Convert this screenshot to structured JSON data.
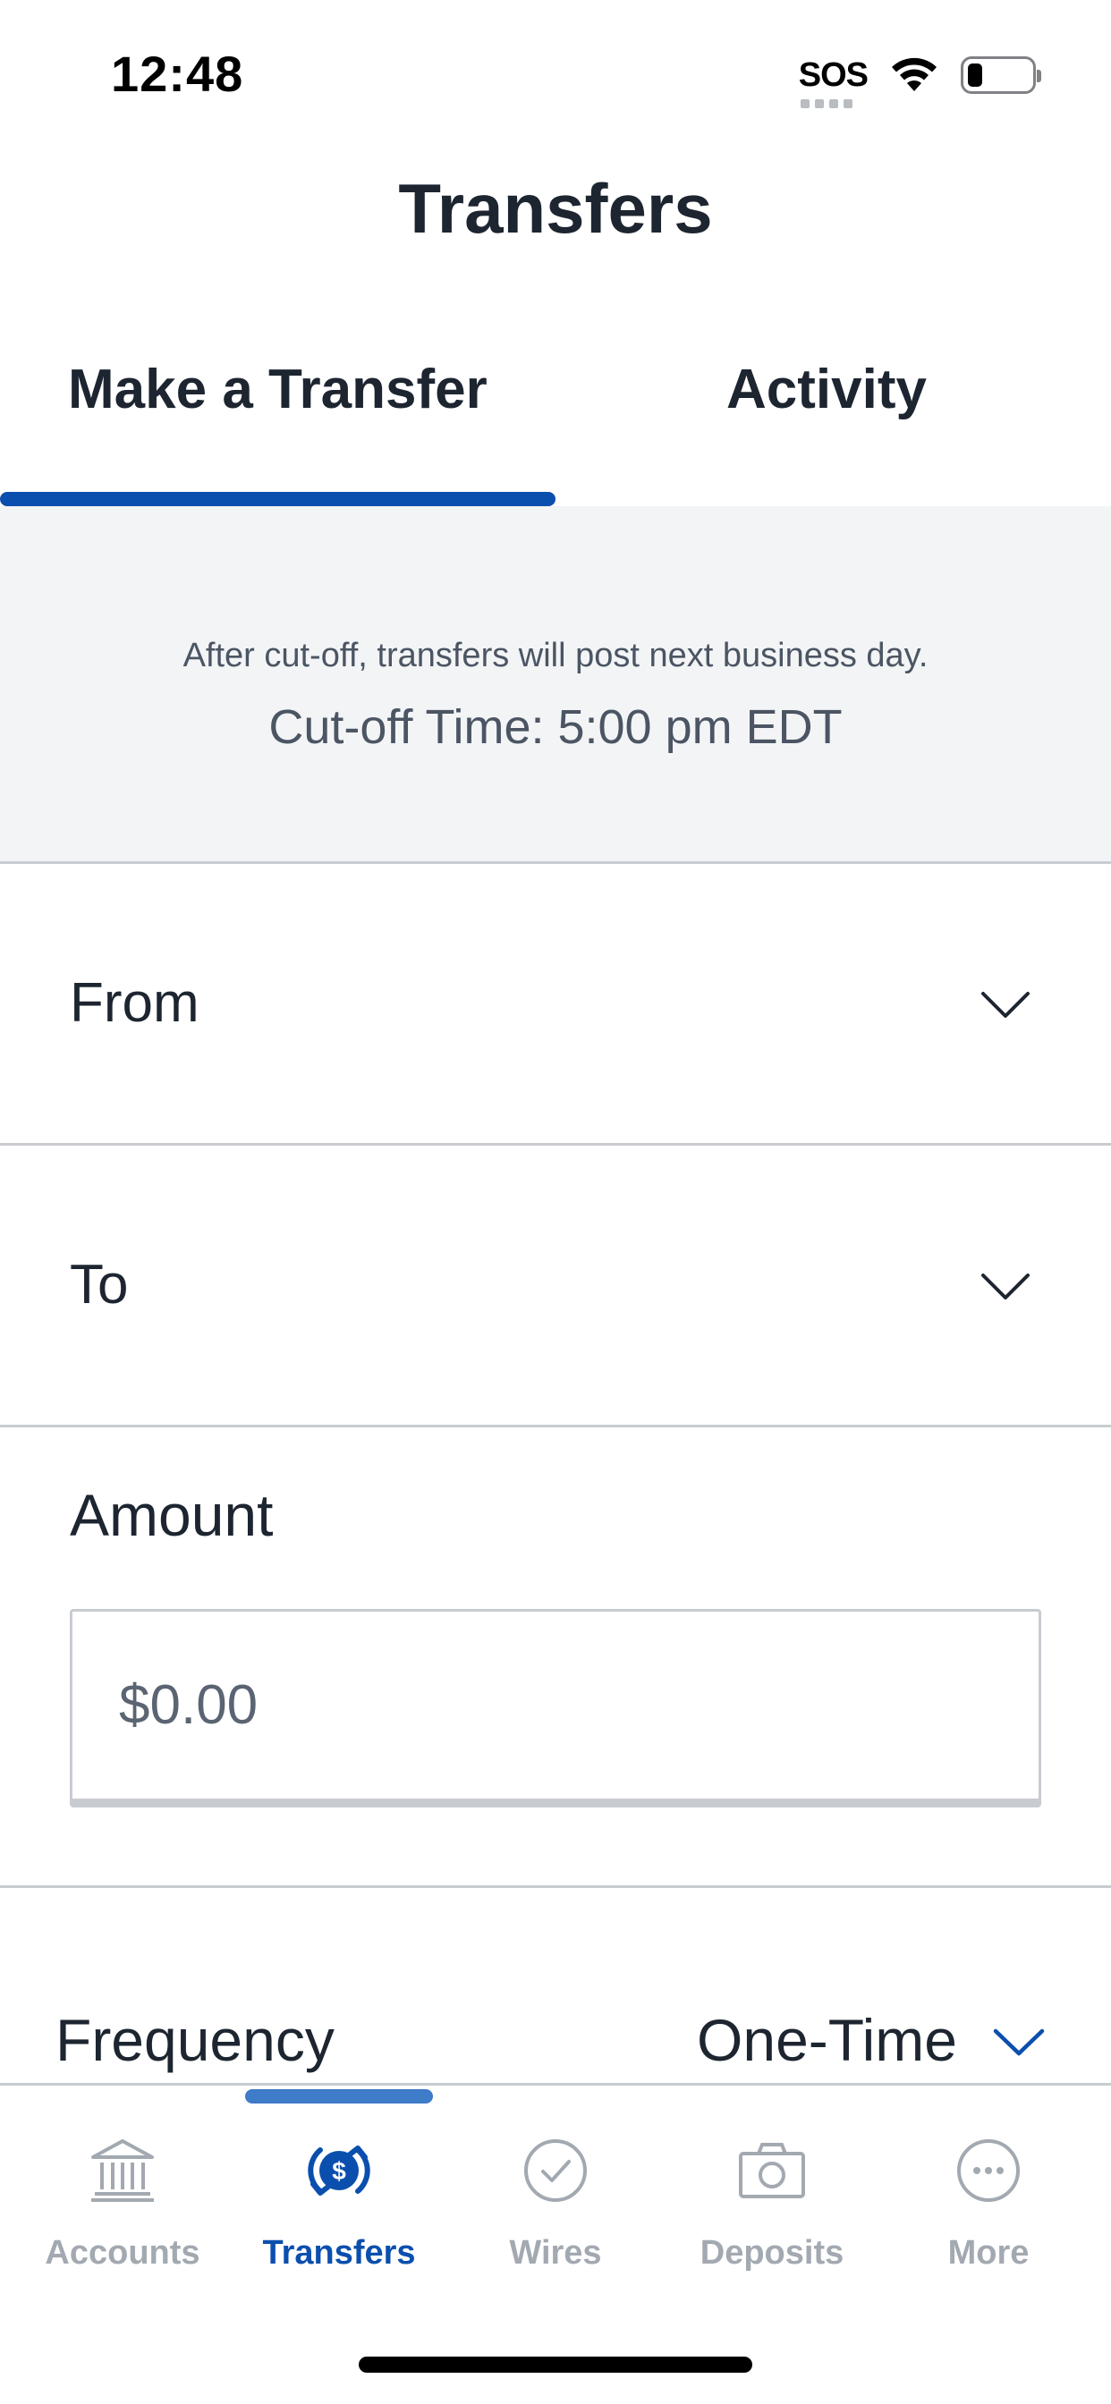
{
  "status_bar": {
    "time": "12:48",
    "sos": "SOS"
  },
  "header": {
    "title": "Transfers"
  },
  "tabs": [
    {
      "label": "Make a Transfer",
      "active": true
    },
    {
      "label": "Activity",
      "active": false
    }
  ],
  "notice": {
    "line1": "After cut-off, transfers will post next business day.",
    "line2": "Cut-off Time: 5:00 pm EDT"
  },
  "form": {
    "from_label": "From",
    "to_label": "To",
    "amount_label": "Amount",
    "amount_placeholder": "$0.00",
    "frequency_label": "Frequency",
    "frequency_value": "One-Time"
  },
  "bottom_nav": [
    {
      "label": "Accounts",
      "icon": "bank-icon",
      "active": false
    },
    {
      "label": "Transfers",
      "icon": "dollar-transfer-icon",
      "active": true
    },
    {
      "label": "Wires",
      "icon": "check-circle-icon",
      "active": false
    },
    {
      "label": "Deposits",
      "icon": "camera-icon",
      "active": false
    },
    {
      "label": "More",
      "icon": "more-dots-icon",
      "active": false
    }
  ],
  "colors": {
    "primary": "#0b4fae",
    "inactive": "#a3a9b1",
    "notice_bg": "#f3f4f6",
    "divider": "#c8ccd1"
  }
}
